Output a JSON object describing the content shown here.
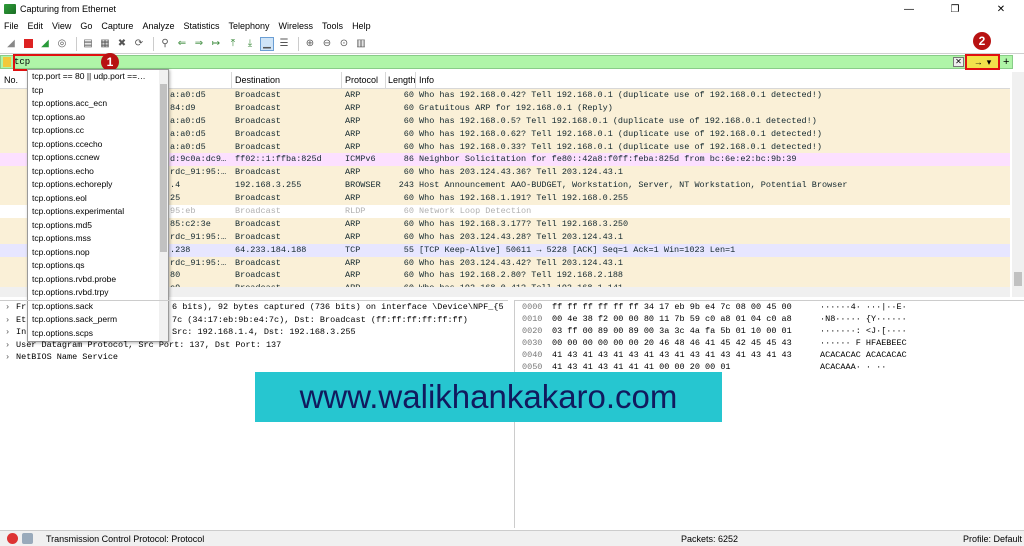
{
  "window": {
    "title": "Capturing from Ethernet",
    "controls": [
      "—",
      "❐",
      "✕"
    ]
  },
  "menu": [
    "File",
    "Edit",
    "View",
    "Go",
    "Capture",
    "Analyze",
    "Statistics",
    "Telephony",
    "Wireless",
    "Tools",
    "Help"
  ],
  "filter": {
    "value": "tcp",
    "apply_label": "→",
    "dropdown_arrow": "▾",
    "clear_label": "✕",
    "add_label": "+"
  },
  "badges": {
    "one": "1",
    "two": "2"
  },
  "columns": {
    "no": "No.",
    "destination": "Destination",
    "protocol": "Protocol",
    "length": "Length",
    "info": "Info"
  },
  "rows": [
    {
      "src": "a:a0:d5",
      "dst": "Broadcast",
      "proto": "ARP",
      "len": "60",
      "info": "Who has 192.168.0.42? Tell 192.168.0.1 (duplicate use of 192.168.0.1 detected!)",
      "bg": "#faf0d7"
    },
    {
      "src": "84:d9",
      "dst": "Broadcast",
      "proto": "ARP",
      "len": "60",
      "info": "Gratuitous ARP for 192.168.0.1 (Reply)",
      "bg": "#faf0d7"
    },
    {
      "src": "a:a0:d5",
      "dst": "Broadcast",
      "proto": "ARP",
      "len": "60",
      "info": "Who has 192.168.0.5? Tell 192.168.0.1 (duplicate use of 192.168.0.1 detected!)",
      "bg": "#faf0d7"
    },
    {
      "src": "a:a0:d5",
      "dst": "Broadcast",
      "proto": "ARP",
      "len": "60",
      "info": "Who has 192.168.0.62? Tell 192.168.0.1 (duplicate use of 192.168.0.1 detected!)",
      "bg": "#faf0d7"
    },
    {
      "src": "a:a0:d5",
      "dst": "Broadcast",
      "proto": "ARP",
      "len": "60",
      "info": "Who has 192.168.0.33? Tell 192.168.0.1 (duplicate use of 192.168.0.1 detected!)",
      "bg": "#faf0d7"
    },
    {
      "src": "d:9c0a:dc9…",
      "dst": "ff02::1:ffba:825d",
      "proto": "ICMPv6",
      "len": "86",
      "info": "Neighbor Solicitation for fe80::42a8:f0ff:feba:825d from bc:6e:e2:bc:9b:39",
      "bg": "#fce0ff"
    },
    {
      "src": "rdc_91:95:…",
      "dst": "Broadcast",
      "proto": "ARP",
      "len": "60",
      "info": "Who has 203.124.43.36? Tell 203.124.43.1",
      "bg": "#faf0d7"
    },
    {
      "src": ".4",
      "dst": "192.168.3.255",
      "proto": "BROWSER",
      "len": "243",
      "info": "Host Announcement AAO-BUDGET, Workstation, Server, NT Workstation, Potential Browser",
      "bg": "#faf0d7"
    },
    {
      "src": "25",
      "dst": "Broadcast",
      "proto": "ARP",
      "len": "60",
      "info": "Who has 192.168.1.191? Tell 192.168.0.255",
      "bg": "#faf0d7"
    },
    {
      "src": "95:eb",
      "dst": "Broadcast",
      "proto": "RLDP",
      "len": "60",
      "info": "Network Loop Detection",
      "bg": "#ffffff",
      "dim": true
    },
    {
      "src": "85:c2:3e",
      "dst": "Broadcast",
      "proto": "ARP",
      "len": "60",
      "info": "Who has 192.168.3.177? Tell 192.168.3.250",
      "bg": "#faf0d7"
    },
    {
      "src": "rdc_91:95:…",
      "dst": "Broadcast",
      "proto": "ARP",
      "len": "60",
      "info": "Who has 203.124.43.28? Tell 203.124.43.1",
      "bg": "#faf0d7"
    },
    {
      "src": ".238",
      "dst": "64.233.184.188",
      "proto": "TCP",
      "len": "55",
      "info": "[TCP Keep-Alive] 50611 → 5228 [ACK] Seq=1 Ack=1 Win=1023 Len=1",
      "bg": "#e7e6ff"
    },
    {
      "src": "rdc_91:95:…",
      "dst": "Broadcast",
      "proto": "ARP",
      "len": "60",
      "info": "Who has 203.124.43.42? Tell 203.124.43.1",
      "bg": "#faf0d7"
    },
    {
      "src": "80",
      "dst": "Broadcast",
      "proto": "ARP",
      "len": "60",
      "info": "Who has 192.168.2.80? Tell 192.168.2.188",
      "bg": "#faf0d7"
    },
    {
      "src": "c9",
      "dst": "Broadcast",
      "proto": "ARP",
      "len": "60",
      "info": "Who has 192.168.0.41? Tell 192.168.1.141",
      "bg": "#faf0d7"
    }
  ],
  "suggestions": [
    "tcp.port == 80 || udp.port ==…",
    "tcp",
    "tcp.options.acc_ecn",
    "tcp.options.ao",
    "tcp.options.cc",
    "tcp.options.ccecho",
    "tcp.options.ccnew",
    "tcp.options.echo",
    "tcp.options.echoreply",
    "tcp.options.eol",
    "tcp.options.experimental",
    "tcp.options.md5",
    "tcp.options.mss",
    "tcp.options.nop",
    "tcp.options.qs",
    "tcp.options.rvbd.probe",
    "tcp.options.rvbd.trpy",
    "tcp.options.sack",
    "tcp.options.sack_perm",
    "tcp.options.scps"
  ],
  "details": [
    {
      "prefix": "Fr",
      "text": "6 bits), 92 bytes captured (736 bits) on interface \\Device\\NPF_{5"
    },
    {
      "prefix": "Et",
      "text": "7c (34:17:eb:9b:e4:7c), Dst: Broadcast (ff:ff:ff:ff:ff:ff)"
    },
    {
      "prefix": "In",
      "text": "Src: 192.168.1.4, Dst: 192.168.3.255"
    },
    {
      "prefix": "",
      "text": "User Datagram Protocol, Src Port: 137, Dst Port: 137"
    },
    {
      "prefix": "",
      "text": "NetBIOS Name Service"
    }
  ],
  "hex": [
    {
      "off": "0000",
      "hex": "ff ff ff ff ff ff 34 17  eb 9b e4 7c 08 00 45 00",
      "ascii": "······4· ···|··E·"
    },
    {
      "off": "0010",
      "hex": "00 4e 38 f2 00 00 80 11  7b 59 c0 a8 01 04 c0 a8",
      "ascii": "·N8····· {Y······"
    },
    {
      "off": "0020",
      "hex": "03 ff 00 89 00 89 00 3a  3c 4a fa 5b 01 10 00 01",
      "ascii": "·······: <J·[····"
    },
    {
      "off": "0030",
      "hex": "00 00 00 00 00 00 20 46  48 46 41 45 42 45 45 43",
      "ascii": "······ F HFAEBEEC"
    },
    {
      "off": "0040",
      "hex": "41 43 41 43 41 43 41 43  41 43 41 43 41 43 41 43",
      "ascii": "ACACACAC ACACACAC"
    },
    {
      "off": "0050",
      "hex": "41 43 41 43 41 41 41 00  00 20 00 01",
      "ascii": "ACACAAA· · ··"
    }
  ],
  "banner": "www.walikhankakaro.com",
  "status": {
    "protocol": "Transmission Control Protocol: Protocol",
    "packets": "Packets: 6252",
    "profile": "Profile: Default"
  }
}
